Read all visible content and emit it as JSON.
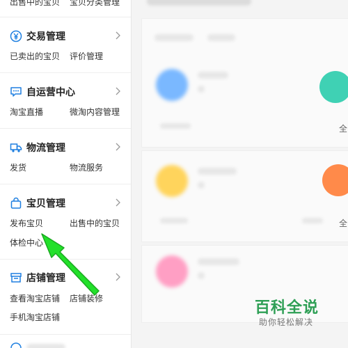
{
  "sidebar": {
    "top_links": [
      "出售中的宝贝",
      "宝贝分类管理"
    ],
    "sections": [
      {
        "title": "交易管理",
        "icon": "yen-circle-icon",
        "links": [
          "已卖出的宝贝",
          "评价管理"
        ]
      },
      {
        "title": "自运营中心",
        "icon": "chat-bubble-icon",
        "links": [
          "淘宝直播",
          "微淘内容管理"
        ]
      },
      {
        "title": "物流管理",
        "icon": "truck-icon",
        "links": [
          "发货",
          "物流服务"
        ]
      },
      {
        "title": "宝贝管理",
        "icon": "shopping-bag-icon",
        "links": [
          "发布宝贝",
          "出售中的宝贝",
          "体检中心"
        ]
      },
      {
        "title": "店铺管理",
        "icon": "storefront-icon",
        "links": [
          "查看淘宝店铺",
          "店铺装修",
          "手机淘宝店铺"
        ]
      }
    ]
  },
  "main": {
    "edge_labels": [
      "全",
      "全"
    ]
  },
  "watermark": {
    "title": "百科全说",
    "subtitle": "助你轻松解决"
  },
  "colors": {
    "accent_blue": "#1e7fe0",
    "arrow_green": "#22e02a",
    "watermark_green": "#2e9f55"
  }
}
